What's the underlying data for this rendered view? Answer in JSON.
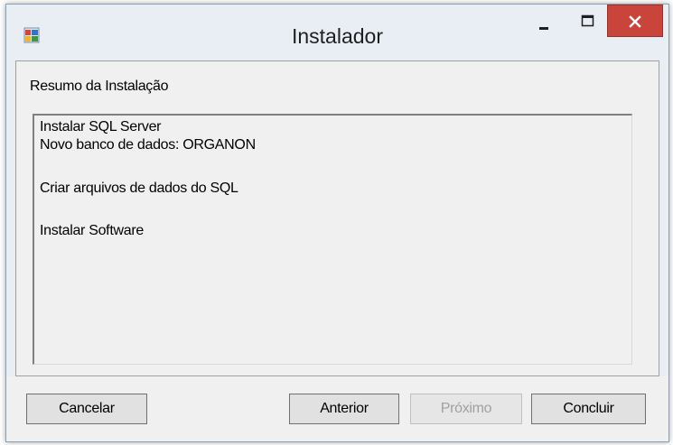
{
  "window": {
    "title": "Instalador"
  },
  "icons": {
    "app": "installer-app-icon",
    "minimize": "minimize-icon",
    "maximize": "maximize-icon",
    "close": "close-icon"
  },
  "colors": {
    "close_button": "#c9453b",
    "window_frame": "#e9eef4",
    "disabled_text": "#a0a0a0"
  },
  "main": {
    "heading": "Resumo da Instalação",
    "summary_lines": [
      "Instalar SQL Server",
      "Novo banco de dados: ORGANON",
      "Criar arquivos de dados do SQL",
      "Instalar Software"
    ]
  },
  "buttons": {
    "cancel": "Cancelar",
    "previous": "Anterior",
    "next": "Próximo",
    "finish": "Concluir"
  }
}
